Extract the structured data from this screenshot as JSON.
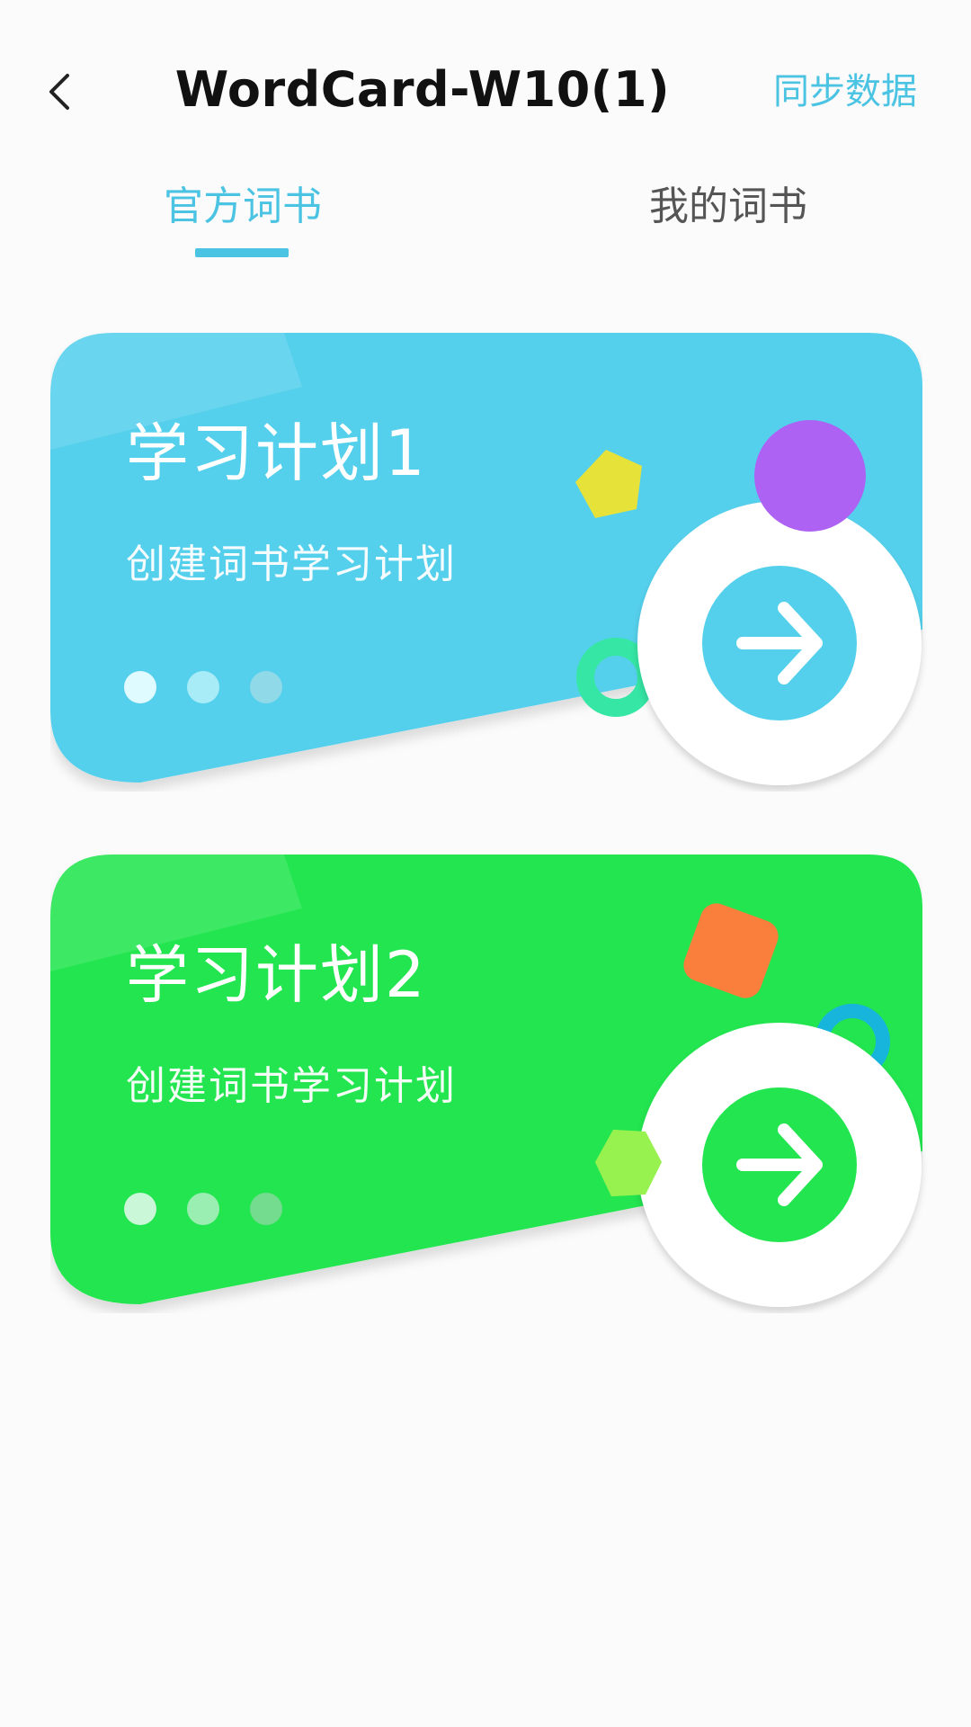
{
  "header": {
    "back_icon": "chevron-left-icon",
    "title": "WordCard-W10(1)",
    "sync_label": "同步数据"
  },
  "tabs": [
    {
      "label": "官方词书",
      "active": true
    },
    {
      "label": "我的词书",
      "active": false
    }
  ],
  "colors": {
    "accent": "#4bc3e2",
    "card1": "#54d0ec",
    "card2": "#22e550"
  },
  "cards": [
    {
      "title": "学习计划1",
      "subtitle": "创建词书学习计划",
      "color": "#54d0ec",
      "button_icon": "arrow-right-icon"
    },
    {
      "title": "学习计划2",
      "subtitle": "创建词书学习计划",
      "color": "#22e550",
      "button_icon": "arrow-right-icon"
    }
  ]
}
